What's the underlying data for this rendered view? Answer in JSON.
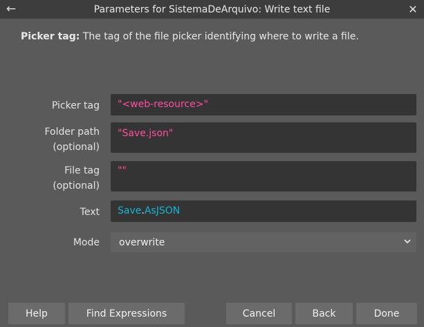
{
  "window": {
    "title": "Parameters for SistemaDeArquivo: Write text file"
  },
  "description": {
    "term": "Picker tag:",
    "text": " The tag of the file picker identifying where to write a file."
  },
  "fields": {
    "picker_tag": {
      "label": "Picker tag",
      "value": "\"<web-resource>\""
    },
    "folder_path": {
      "label_line1": "Folder path",
      "label_line2": "(optional)",
      "value": "\"Save.json\""
    },
    "file_tag": {
      "label_line1": "File tag",
      "label_line2": "(optional)",
      "value": "\"\""
    },
    "text": {
      "label": "Text",
      "value_object": "Save",
      "value_dot": ".",
      "value_member": "AsJSON"
    },
    "mode": {
      "label": "Mode",
      "selected": "overwrite"
    }
  },
  "buttons": {
    "help": "Help",
    "find_expressions": "Find Expressions",
    "cancel": "Cancel",
    "back": "Back",
    "done": "Done"
  },
  "colors": {
    "string_literal": "#ff4fa3",
    "identifier": "#16b6d6"
  }
}
